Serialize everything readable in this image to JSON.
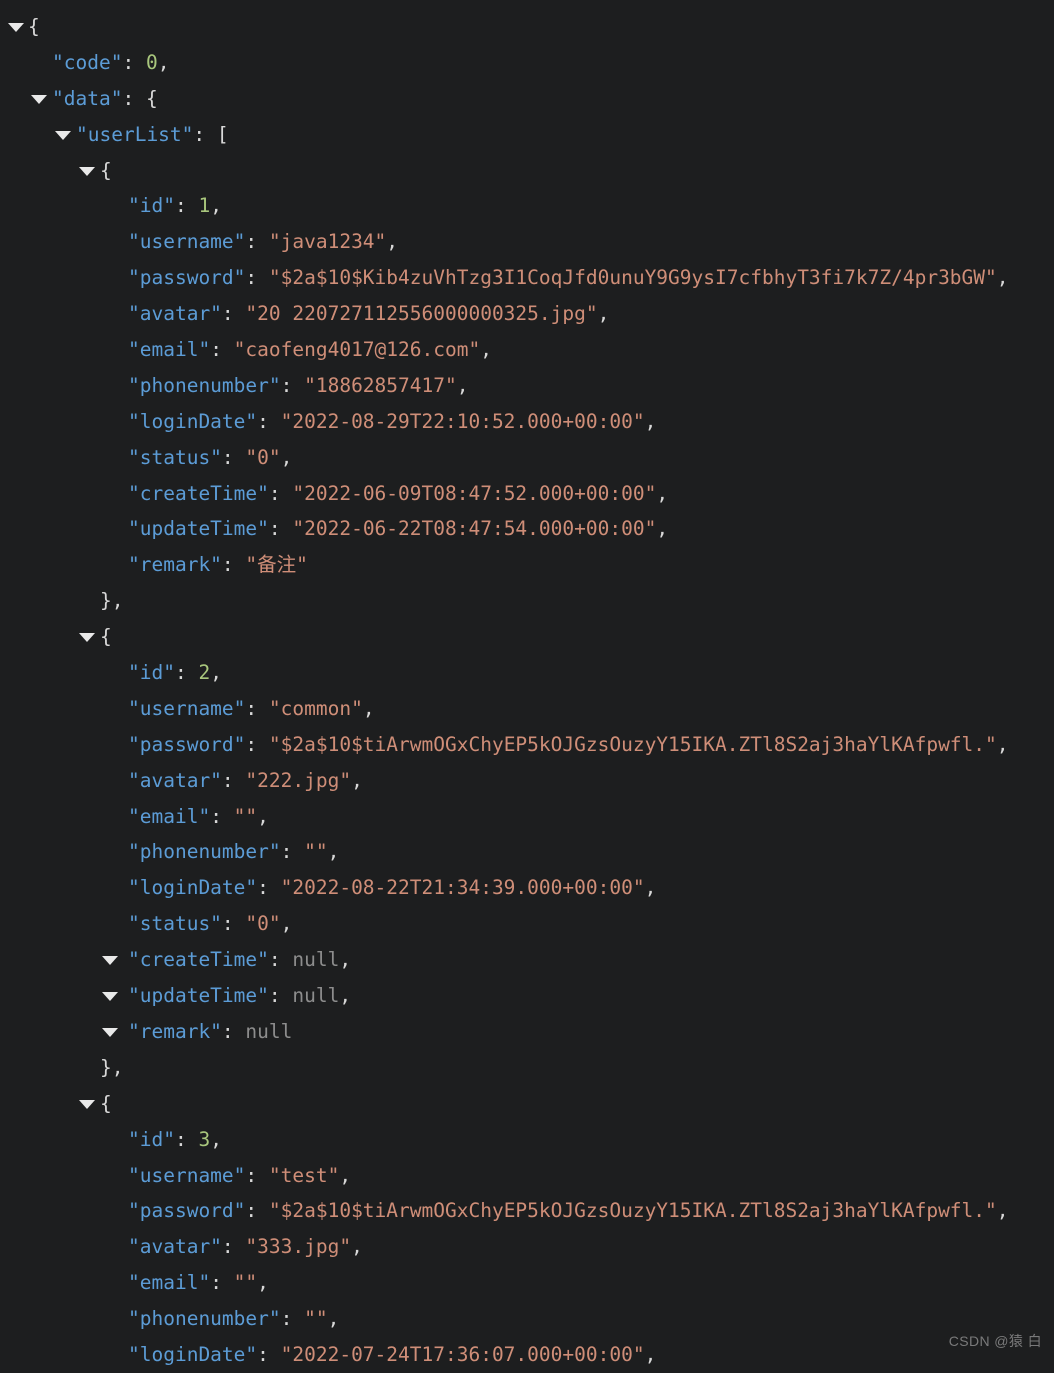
{
  "viewer": {
    "theme": "dark",
    "background_color": "#1d1e1f",
    "key_color": "#5c9cd6",
    "string_color": "#cf8e78",
    "number_color": "#a9c77d",
    "null_color": "#8d8d8d",
    "punctuation_color": "#d8d8d8",
    "collapse_icon": "triangle-down"
  },
  "watermark": "CSDN @猿 白",
  "json": {
    "code": 0,
    "data": {
      "userList": [
        {
          "id": 1,
          "username": "java1234",
          "password": "$2a$10$Kib4zuVhTzg3I1CoqJfd0unuY9G9ysI7cfbhyT3fi7k7Z/4pr3bGW",
          "avatar": "20 220727112556000000325.jpg",
          "email": "caofeng4017@126.com",
          "phonenumber": "18862857417",
          "loginDate": "2022-08-29T22:10:52.000+00:00",
          "status": "0",
          "createTime": "2022-06-09T08:47:52.000+00:00",
          "updateTime": "2022-06-22T08:47:54.000+00:00",
          "remark": "备注"
        },
        {
          "id": 2,
          "username": "common",
          "password": "$2a$10$tiArwmOGxChyEP5kOJGzsOuzyY15IKA.ZTl8S2aj3haYlKAfpwfl.",
          "avatar": "222.jpg",
          "email": "",
          "phonenumber": "",
          "loginDate": "2022-08-22T21:34:39.000+00:00",
          "status": "0",
          "createTime": null,
          "updateTime": null,
          "remark": null
        },
        {
          "id": 3,
          "username": "test",
          "password": "$2a$10$tiArwmOGxChyEP5kOJGzsOuzyY15IKA.ZTl8S2aj3haYlKAfpwfl.",
          "avatar": "333.jpg",
          "email": "",
          "phonenumber": "",
          "loginDate": "2022-07-24T17:36:07.000+00:00"
        }
      ]
    }
  },
  "lines": [
    {
      "indent": 0,
      "tri": 0,
      "key": null,
      "punct_open": "{",
      "type": "brace"
    },
    {
      "indent": 1,
      "tri": null,
      "key": "code",
      "value": "0",
      "type": "number",
      "comma": true
    },
    {
      "indent": 1,
      "tri": 1,
      "key": "data",
      "punct_open": "{",
      "type": "brace"
    },
    {
      "indent": 2,
      "tri": 2,
      "key": "userList",
      "punct_open": "[",
      "type": "bracket"
    },
    {
      "indent": 3,
      "tri": 3,
      "key": null,
      "punct_open": "{",
      "type": "brace"
    },
    {
      "indent": 4,
      "tri": null,
      "key": "id",
      "value": "1",
      "type": "number",
      "comma": true
    },
    {
      "indent": 4,
      "tri": null,
      "key": "username",
      "value": "java1234",
      "type": "string",
      "comma": true
    },
    {
      "indent": 4,
      "tri": null,
      "key": "password",
      "value": "$2a$10$Kib4zuVhTzg3I1CoqJfd0unuY9G9ysI7cfbhyT3fi7k7Z/4pr3bGW",
      "type": "string",
      "comma": true
    },
    {
      "indent": 4,
      "tri": null,
      "key": "avatar",
      "value": "20 220727112556000000325.jpg",
      "type": "string",
      "comma": true
    },
    {
      "indent": 4,
      "tri": null,
      "key": "email",
      "value": "caofeng4017@126.com",
      "type": "string",
      "comma": true
    },
    {
      "indent": 4,
      "tri": null,
      "key": "phonenumber",
      "value": "18862857417",
      "type": "string",
      "comma": true
    },
    {
      "indent": 4,
      "tri": null,
      "key": "loginDate",
      "value": "2022-08-29T22:10:52.000+00:00",
      "type": "string",
      "comma": true
    },
    {
      "indent": 4,
      "tri": null,
      "key": "status",
      "value": "0",
      "type": "string",
      "comma": true
    },
    {
      "indent": 4,
      "tri": null,
      "key": "createTime",
      "value": "2022-06-09T08:47:52.000+00:00",
      "type": "string",
      "comma": true
    },
    {
      "indent": 4,
      "tri": null,
      "key": "updateTime",
      "value": "2022-06-22T08:47:54.000+00:00",
      "type": "string",
      "comma": true
    },
    {
      "indent": 4,
      "tri": null,
      "key": "remark",
      "value": "备注",
      "type": "string",
      "comma": false
    },
    {
      "indent": 3,
      "tri": null,
      "key": null,
      "punct_close": "},",
      "type": "close"
    },
    {
      "indent": 3,
      "tri": 3,
      "key": null,
      "punct_open": "{",
      "type": "brace"
    },
    {
      "indent": 4,
      "tri": null,
      "key": "id",
      "value": "2",
      "type": "number",
      "comma": true
    },
    {
      "indent": 4,
      "tri": null,
      "key": "username",
      "value": "common",
      "type": "string",
      "comma": true
    },
    {
      "indent": 4,
      "tri": null,
      "key": "password",
      "value": "$2a$10$tiArwmOGxChyEP5kOJGzsOuzyY15IKA.ZTl8S2aj3haYlKAfpwfl.",
      "type": "string",
      "comma": true
    },
    {
      "indent": 4,
      "tri": null,
      "key": "avatar",
      "value": "222.jpg",
      "type": "string",
      "comma": true
    },
    {
      "indent": 4,
      "tri": null,
      "key": "email",
      "value": "",
      "type": "string",
      "comma": true
    },
    {
      "indent": 4,
      "tri": null,
      "key": "phonenumber",
      "value": "",
      "type": "string",
      "comma": true
    },
    {
      "indent": 4,
      "tri": null,
      "key": "loginDate",
      "value": "2022-08-22T21:34:39.000+00:00",
      "type": "string",
      "comma": true
    },
    {
      "indent": 4,
      "tri": null,
      "key": "status",
      "value": "0",
      "type": "string",
      "comma": true
    },
    {
      "indent": 4,
      "tri": 4,
      "key": "createTime",
      "value": "null",
      "type": "null",
      "comma": true
    },
    {
      "indent": 4,
      "tri": 4,
      "key": "updateTime",
      "value": "null",
      "type": "null",
      "comma": true
    },
    {
      "indent": 4,
      "tri": 4,
      "key": "remark",
      "value": "null",
      "type": "null",
      "comma": false
    },
    {
      "indent": 3,
      "tri": null,
      "key": null,
      "punct_close": "},",
      "type": "close"
    },
    {
      "indent": 3,
      "tri": 3,
      "key": null,
      "punct_open": "{",
      "type": "brace"
    },
    {
      "indent": 4,
      "tri": null,
      "key": "id",
      "value": "3",
      "type": "number",
      "comma": true
    },
    {
      "indent": 4,
      "tri": null,
      "key": "username",
      "value": "test",
      "type": "string",
      "comma": true
    },
    {
      "indent": 4,
      "tri": null,
      "key": "password",
      "value": "$2a$10$tiArwmOGxChyEP5kOJGzsOuzyY15IKA.ZTl8S2aj3haYlKAfpwfl.",
      "type": "string",
      "comma": true
    },
    {
      "indent": 4,
      "tri": null,
      "key": "avatar",
      "value": "333.jpg",
      "type": "string",
      "comma": true
    },
    {
      "indent": 4,
      "tri": null,
      "key": "email",
      "value": "",
      "type": "string",
      "comma": true
    },
    {
      "indent": 4,
      "tri": null,
      "key": "phonenumber",
      "value": "",
      "type": "string",
      "comma": true
    },
    {
      "indent": 4,
      "tri": null,
      "key": "loginDate",
      "value": "2022-07-24T17:36:07.000+00:00",
      "type": "string",
      "comma": true
    }
  ]
}
